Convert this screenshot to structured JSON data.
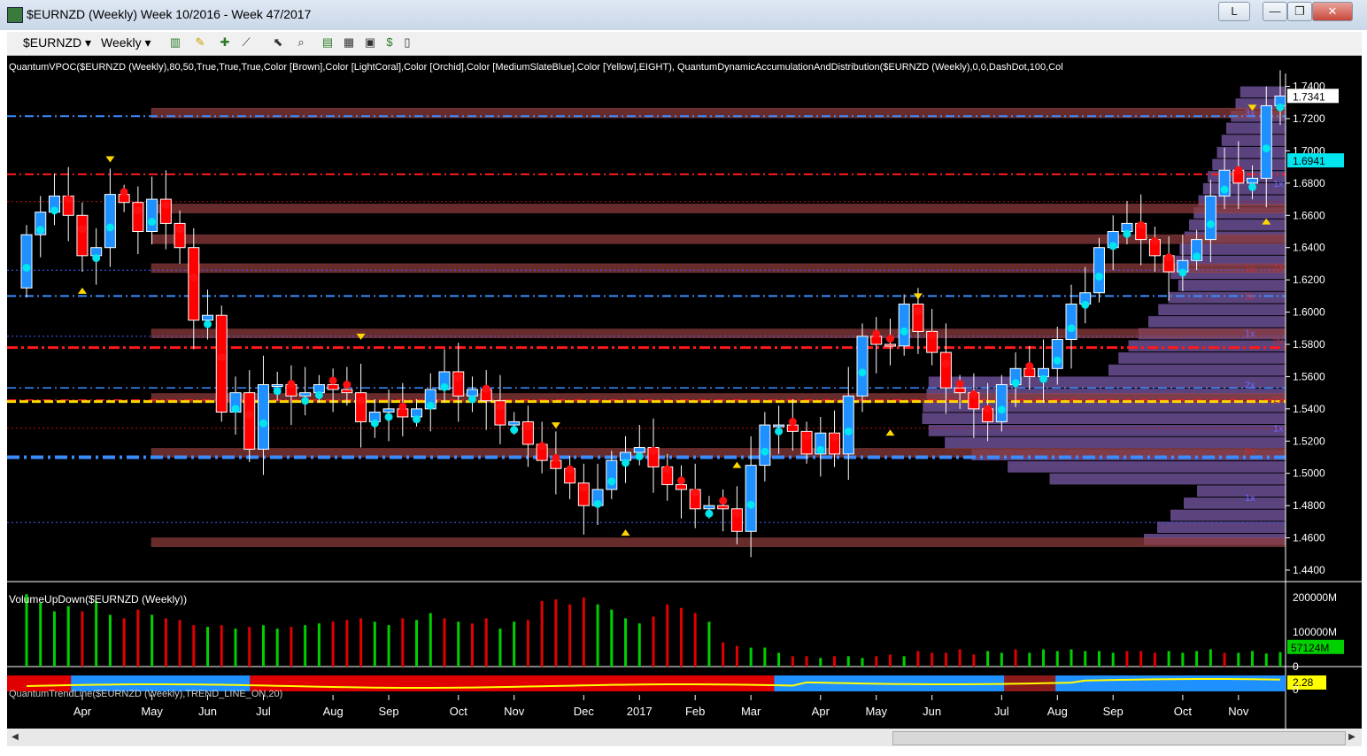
{
  "window": {
    "title": "$EURNZD (Weekly)  Week 10/2016 - Week 47/2017",
    "btn_l": "L",
    "btn_min": "—",
    "btn_max": "❐",
    "btn_close": "✕"
  },
  "toolbar": {
    "symbol": "$EURNZD",
    "interval": "Weekly",
    "dropdown_glyph": "▾"
  },
  "chart": {
    "indicator_label": "QuantumVPOC($EURNZD  (Weekly),80,50,True,True,True,Color  [Brown],Color  [LightCoral],Color  [Orchid],Color  [MediumSlateBlue],Color  [Yellow],EIGHT),  QuantumDynamicAccumulationAndDistribution($EURNZD  (Weekly),0,0,DashDot,100,Col",
    "volume_label": "VolumeUpDown($EURNZD (Weekly))",
    "trend_label": "QuantumTrendLine($EURNZD  (Weekly),TREND_LINE_ON,20)",
    "price_ticks": [
      "1.7400",
      "1.7200",
      "1.7000",
      "1.6800",
      "1.6600",
      "1.6400",
      "1.6200",
      "1.6000",
      "1.5800",
      "1.5600",
      "1.5400",
      "1.5200",
      "1.5000",
      "1.4800",
      "1.4600",
      "1.4400"
    ],
    "last_price": "1.7341",
    "marker_price": "1.6941",
    "volume_ticks": [
      "200000M",
      "100000M",
      "0"
    ],
    "volume_current": "57124M",
    "trend_value": "2.28",
    "trend_zero": "0",
    "months": [
      "Apr",
      "May",
      "Jun",
      "Jul",
      "Aug",
      "Sep",
      "Oct",
      "Nov",
      "Dec",
      "2017",
      "Feb",
      "Mar",
      "Apr",
      "May",
      "Jun",
      "Jul",
      "Aug",
      "Sep",
      "Oct",
      "Nov"
    ],
    "vp_labels": [
      "3x",
      "1x",
      "1x",
      "3x",
      "1x",
      "3x",
      "2x",
      "2x",
      "1x",
      "6x",
      "1x",
      "1x"
    ]
  },
  "colors": {
    "up": "#1e90ff",
    "down": "#ff0000",
    "vol_up": "#00d000",
    "vol_down": "#e00000",
    "vpoc": "#ffd700",
    "bg": "#000000"
  },
  "chart_data": {
    "type": "candlestick",
    "instrument": "$EURNZD",
    "interval": "Weekly",
    "ylim": [
      1.44,
      1.74
    ],
    "x": [
      "2016-W10",
      "2016-W11",
      "2016-W12",
      "2016-W13",
      "2016-W14",
      "2016-W15",
      "2016-W16",
      "2016-W17",
      "2016-W18",
      "2016-W19",
      "2016-W20",
      "2016-W21",
      "2016-W22",
      "2016-W23",
      "2016-W24",
      "2016-W25",
      "2016-W26",
      "2016-W27",
      "2016-W28",
      "2016-W29",
      "2016-W30",
      "2016-W31",
      "2016-W32",
      "2016-W33",
      "2016-W34",
      "2016-W35",
      "2016-W36",
      "2016-W37",
      "2016-W38",
      "2016-W39",
      "2016-W40",
      "2016-W41",
      "2016-W42",
      "2016-W43",
      "2016-W44",
      "2016-W45",
      "2016-W46",
      "2016-W47",
      "2016-W48",
      "2016-W49",
      "2016-W50",
      "2016-W51",
      "2016-W52",
      "2017-W01",
      "2017-W02",
      "2017-W03",
      "2017-W04",
      "2017-W05",
      "2017-W06",
      "2017-W07",
      "2017-W08",
      "2017-W09",
      "2017-W10",
      "2017-W11",
      "2017-W12",
      "2017-W13",
      "2017-W14",
      "2017-W15",
      "2017-W16",
      "2017-W17",
      "2017-W18",
      "2017-W19",
      "2017-W20",
      "2017-W21",
      "2017-W22",
      "2017-W23",
      "2017-W24",
      "2017-W25",
      "2017-W26",
      "2017-W27",
      "2017-W28",
      "2017-W29",
      "2017-W30",
      "2017-W31",
      "2017-W32",
      "2017-W33",
      "2017-W34",
      "2017-W35",
      "2017-W36",
      "2017-W37",
      "2017-W38",
      "2017-W39",
      "2017-W40",
      "2017-W41",
      "2017-W42",
      "2017-W43",
      "2017-W44",
      "2017-W45",
      "2017-W46",
      "2017-W47"
    ],
    "open": [
      1.615,
      1.648,
      1.662,
      1.672,
      1.66,
      1.635,
      1.64,
      1.673,
      1.668,
      1.65,
      1.67,
      1.655,
      1.64,
      1.595,
      1.598,
      1.538,
      1.55,
      1.515,
      1.555,
      1.555,
      1.548,
      1.55,
      1.555,
      1.552,
      1.55,
      1.532,
      1.538,
      1.54,
      1.535,
      1.54,
      1.552,
      1.563,
      1.548,
      1.552,
      1.545,
      1.53,
      1.532,
      1.518,
      1.508,
      1.503,
      1.494,
      1.48,
      1.49,
      1.508,
      1.513,
      1.516,
      1.504,
      1.493,
      1.49,
      1.478,
      1.48,
      1.478,
      1.464,
      1.505,
      1.53,
      1.53,
      1.526,
      1.512,
      1.525,
      1.512,
      1.548,
      1.585,
      1.58,
      1.579,
      1.605,
      1.588,
      1.575,
      1.553,
      1.55,
      1.54,
      1.532,
      1.555,
      1.565,
      1.56,
      1.565,
      1.583,
      1.605,
      1.612,
      1.64,
      1.65,
      1.655,
      1.645,
      1.635,
      1.625,
      1.632,
      1.645,
      1.672,
      1.688,
      1.68,
      1.683,
      1.728
    ],
    "close": [
      1.648,
      1.662,
      1.672,
      1.66,
      1.635,
      1.64,
      1.673,
      1.668,
      1.65,
      1.67,
      1.655,
      1.64,
      1.595,
      1.598,
      1.538,
      1.55,
      1.515,
      1.555,
      1.555,
      1.548,
      1.55,
      1.555,
      1.552,
      1.55,
      1.532,
      1.538,
      1.54,
      1.535,
      1.54,
      1.552,
      1.563,
      1.548,
      1.552,
      1.545,
      1.53,
      1.532,
      1.518,
      1.508,
      1.503,
      1.494,
      1.48,
      1.49,
      1.508,
      1.513,
      1.516,
      1.504,
      1.493,
      1.49,
      1.478,
      1.48,
      1.478,
      1.464,
      1.505,
      1.53,
      1.53,
      1.526,
      1.512,
      1.525,
      1.512,
      1.548,
      1.585,
      1.58,
      1.579,
      1.605,
      1.588,
      1.575,
      1.553,
      1.55,
      1.54,
      1.532,
      1.555,
      1.565,
      1.56,
      1.565,
      1.583,
      1.605,
      1.612,
      1.64,
      1.65,
      1.655,
      1.645,
      1.635,
      1.625,
      1.632,
      1.645,
      1.672,
      1.688,
      1.68,
      1.683,
      1.728,
      1.734
    ]
  },
  "volume_data": {
    "values": [
      210,
      185,
      160,
      175,
      160,
      190,
      150,
      140,
      165,
      150,
      140,
      135,
      120,
      115,
      120,
      110,
      115,
      120,
      110,
      115,
      120,
      125,
      130,
      135,
      140,
      130,
      120,
      140,
      135,
      155,
      140,
      130,
      125,
      140,
      110,
      130,
      135,
      190,
      195,
      180,
      200,
      180,
      165,
      140,
      125,
      145,
      180,
      170,
      155,
      130,
      70,
      60,
      55,
      55,
      40,
      30,
      30,
      25,
      30,
      30,
      25,
      30,
      35,
      30,
      45,
      40,
      40,
      50,
      35,
      45,
      40,
      50,
      40,
      50,
      45,
      50,
      45,
      45,
      40,
      45,
      45,
      40,
      45,
      40,
      45,
      50,
      40,
      40,
      45,
      38,
      42
    ],
    "up": [
      1,
      1,
      1,
      1,
      0,
      1,
      1,
      0,
      0,
      1,
      0,
      0,
      0,
      1,
      0,
      1,
      0,
      1,
      1,
      0,
      1,
      1,
      0,
      0,
      0,
      1,
      1,
      0,
      1,
      1,
      0,
      1,
      0,
      0,
      1,
      1,
      0,
      0,
      0,
      0,
      0,
      1,
      1,
      1,
      1,
      0,
      0,
      0,
      0,
      1,
      0,
      0,
      1,
      1,
      1,
      0,
      0,
      1,
      0,
      1,
      1,
      0,
      0,
      1,
      0,
      0,
      0,
      0,
      0,
      1,
      1,
      0,
      1,
      1,
      1,
      1,
      1,
      1,
      1,
      0,
      0,
      0,
      1,
      1,
      1,
      1,
      0,
      1,
      1,
      1,
      1
    ]
  }
}
